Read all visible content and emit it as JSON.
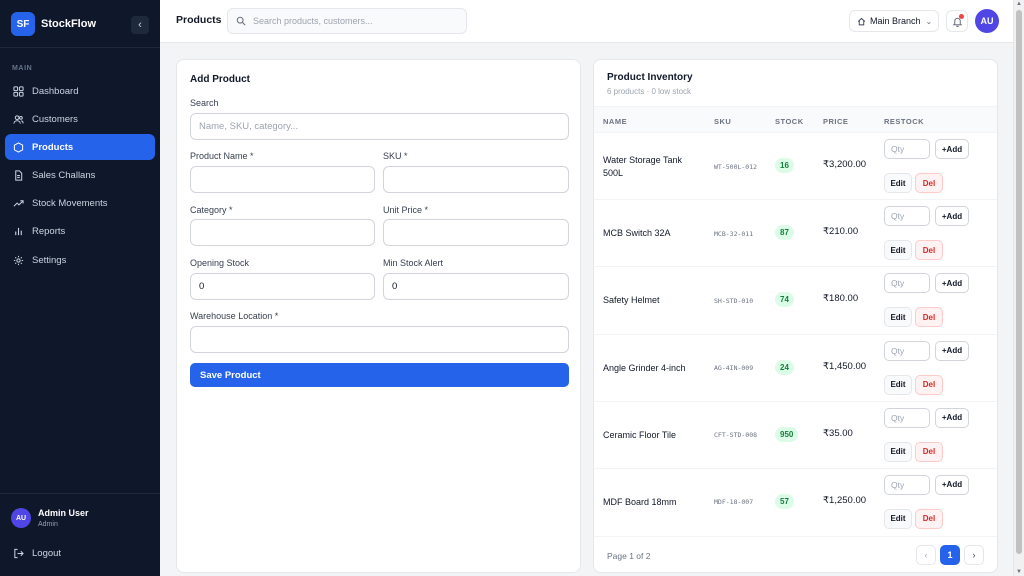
{
  "brand": {
    "logo_text": "SF",
    "name": "StockFlow"
  },
  "sidebar": {
    "collapse_icon": "chevron-left-icon",
    "section_label": "MAIN",
    "items": [
      {
        "label": "Dashboard",
        "icon": "grid-icon"
      },
      {
        "label": "Customers",
        "icon": "users-icon"
      },
      {
        "label": "Products",
        "icon": "box-icon"
      },
      {
        "label": "Sales Challans",
        "icon": "document-icon"
      },
      {
        "label": "Stock Movements",
        "icon": "trend-icon"
      },
      {
        "label": "Reports",
        "icon": "bar-chart-icon"
      },
      {
        "label": "Settings",
        "icon": "gear-icon"
      }
    ],
    "active_item": "Products",
    "user": {
      "initials": "AU",
      "name": "Admin User",
      "role": "Admin"
    },
    "logout_label": "Logout"
  },
  "topbar": {
    "title": "Products",
    "search_placeholder": "Search products, customers...",
    "branch_label": "Main Branch",
    "avatar_initials": "AU"
  },
  "add_product": {
    "title": "Add Product",
    "search": {
      "label": "Search",
      "placeholder": "Name, SKU, category..."
    },
    "product_name": {
      "label": "Product Name *",
      "value": ""
    },
    "sku": {
      "label": "SKU *",
      "value": ""
    },
    "category": {
      "label": "Category *",
      "value": ""
    },
    "unit_price": {
      "label": "Unit Price *",
      "value": ""
    },
    "opening_stock": {
      "label": "Opening Stock",
      "value": "0"
    },
    "min_stock_alert": {
      "label": "Min Stock Alert",
      "value": "0"
    },
    "warehouse_location": {
      "label": "Warehouse Location *",
      "value": ""
    },
    "save_label": "Save Product"
  },
  "inventory": {
    "title": "Product Inventory",
    "subtitle": "6 products · 0 low stock",
    "columns": [
      "NAME",
      "SKU",
      "STOCK",
      "PRICE",
      "RESTOCK"
    ],
    "qty_placeholder": "Qty",
    "add_label": "+Add",
    "edit_label": "Edit",
    "del_label": "Del",
    "rows": [
      {
        "name": "Water Storage Tank 500L",
        "sku": "WT-500L-012",
        "stock": "16",
        "price": "₹3,200.00"
      },
      {
        "name": "MCB Switch 32A",
        "sku": "MCB-32-011",
        "stock": "87",
        "price": "₹210.00"
      },
      {
        "name": "Safety Helmet",
        "sku": "SH-STD-010",
        "stock": "74",
        "price": "₹180.00"
      },
      {
        "name": "Angle Grinder 4-inch",
        "sku": "AG-4IN-009",
        "stock": "24",
        "price": "₹1,450.00"
      },
      {
        "name": "Ceramic Floor Tile",
        "sku": "CFT-STD-008",
        "stock": "950",
        "price": "₹35.00"
      },
      {
        "name": "MDF Board 18mm",
        "sku": "MDF-18-007",
        "stock": "57",
        "price": "₹1,250.00"
      }
    ],
    "pagination": {
      "info": "Page 1 of 2",
      "prev": "‹",
      "current": "1",
      "next": "›"
    }
  },
  "colors": {
    "accent": "#2563eb",
    "sidebar_bg": "#0f172a",
    "stock_badge_bg": "#dcfce7",
    "stock_badge_text": "#15803d",
    "danger": "#dc2626"
  }
}
